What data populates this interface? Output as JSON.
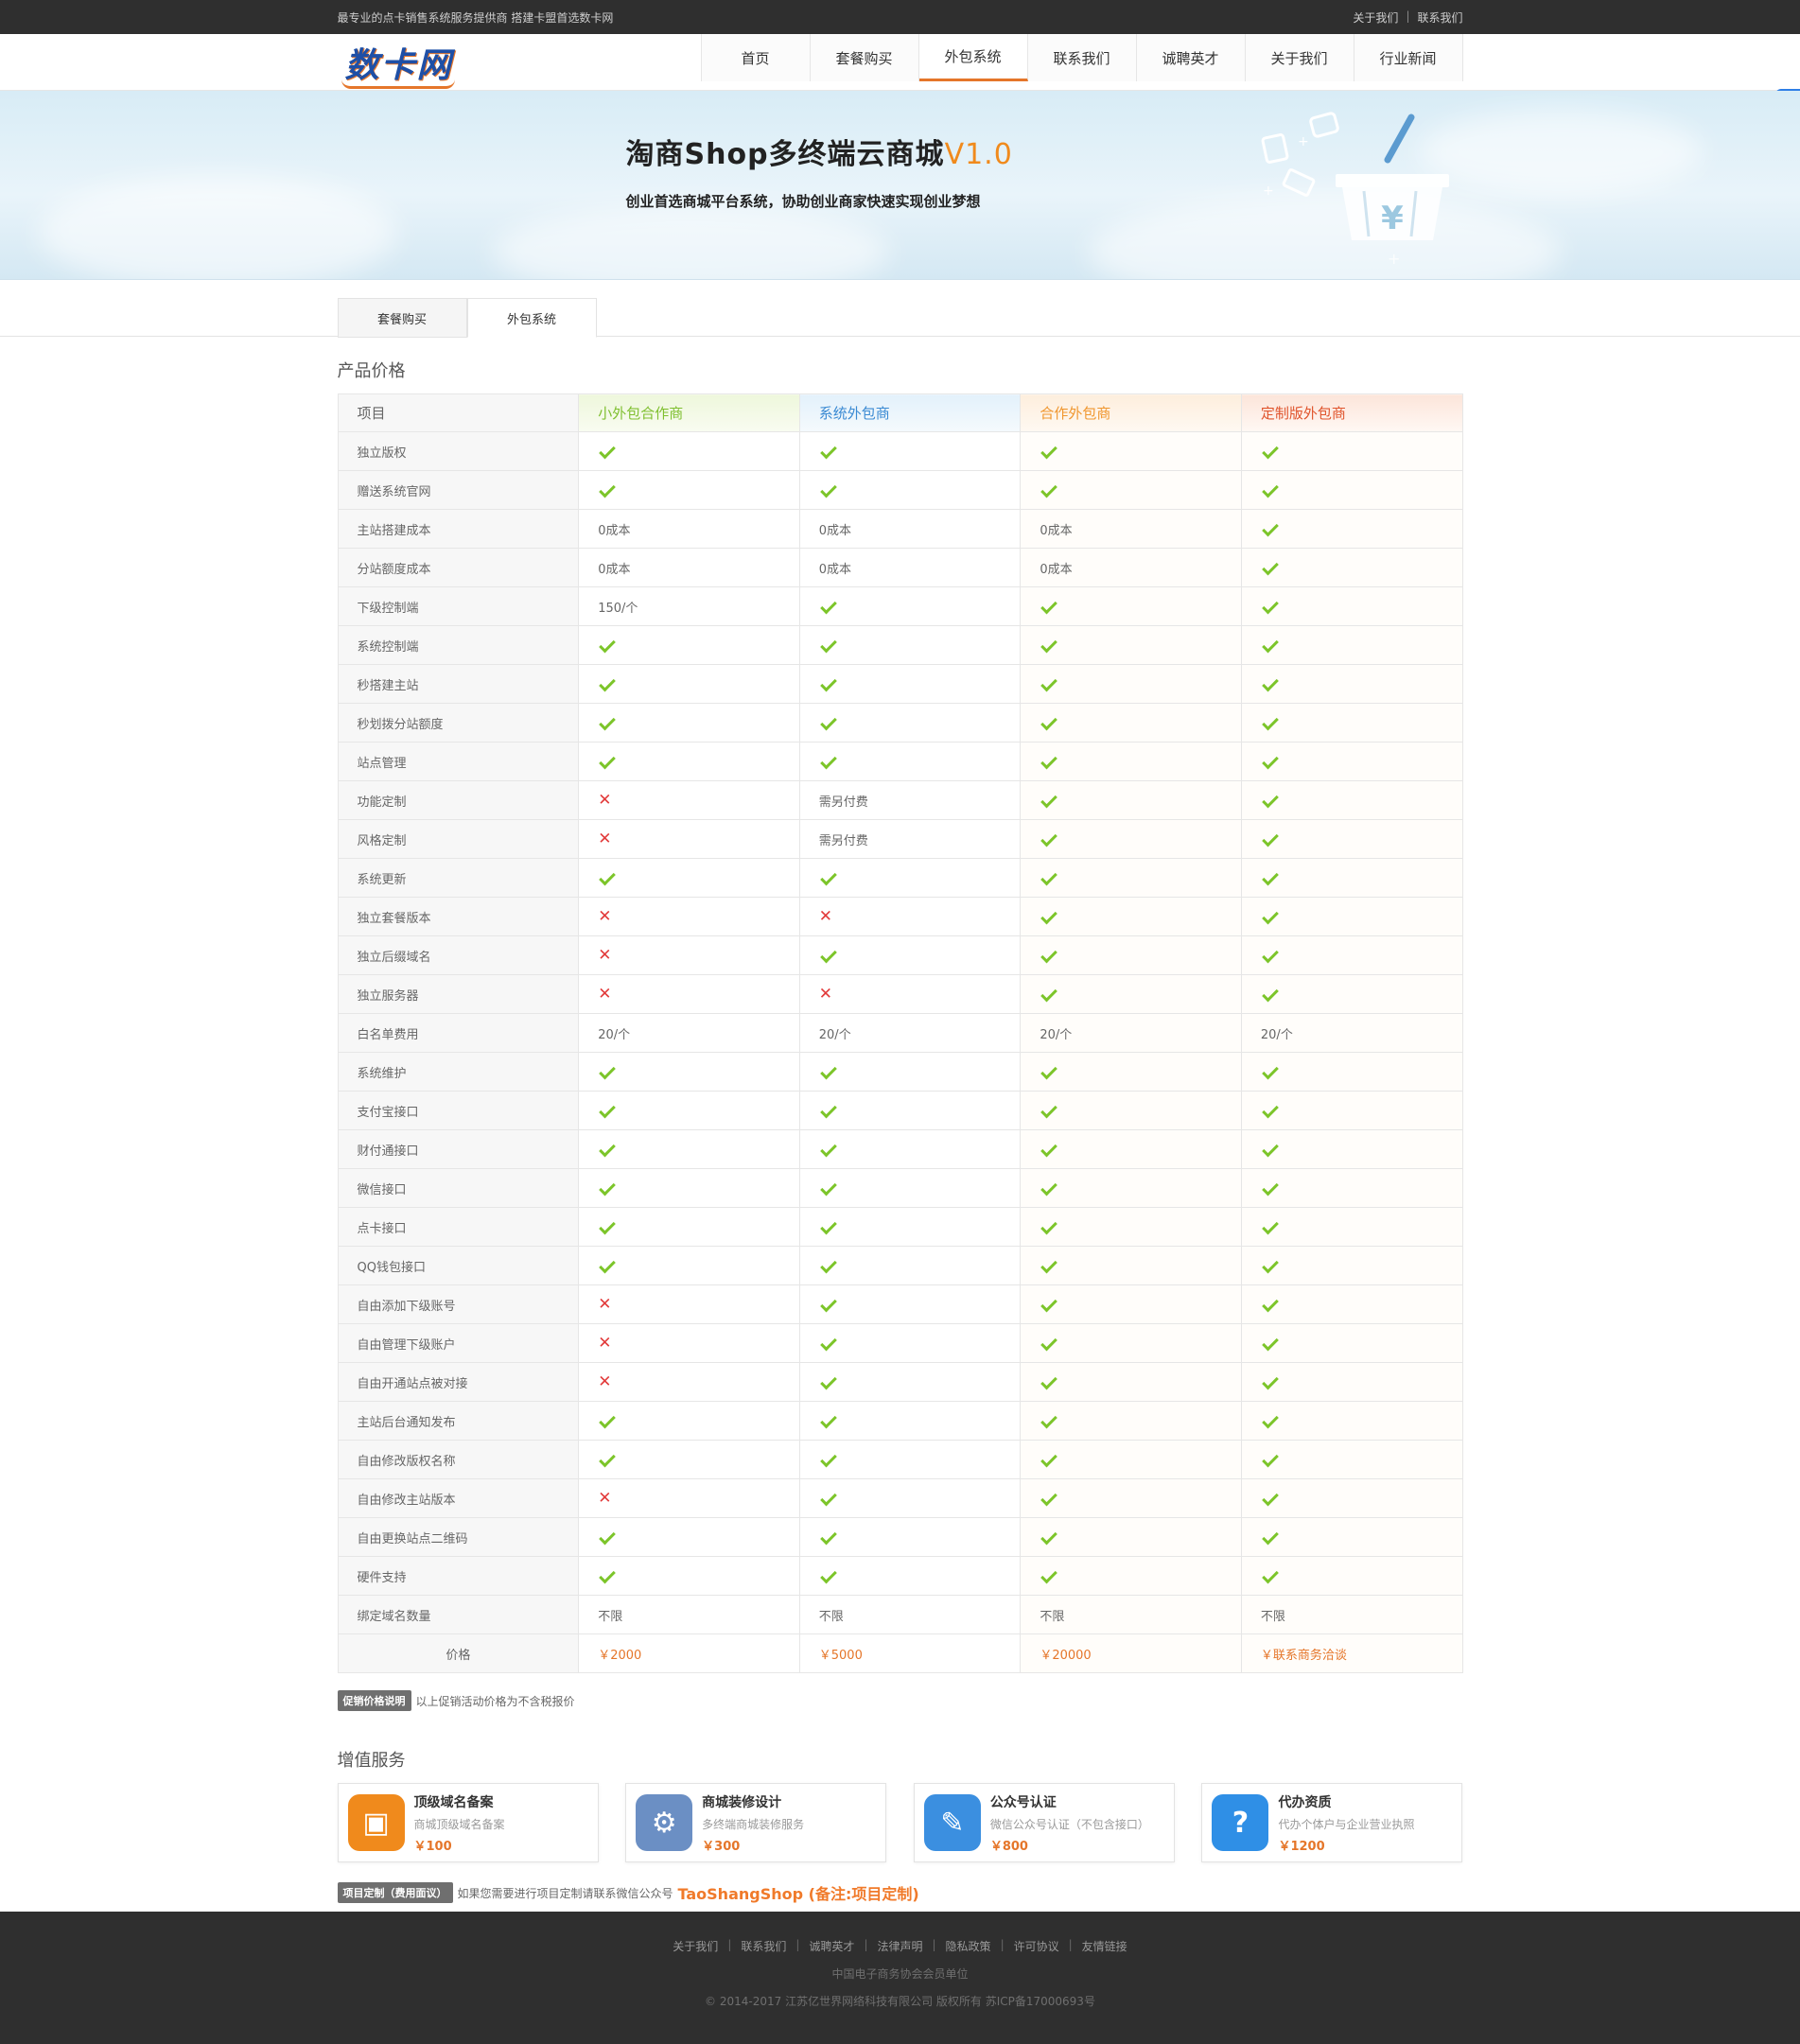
{
  "topbar": {
    "slogan": "最专业的点卡销售系统服务提供商 搭建卡盟首选数卡网",
    "links": [
      "关于我们",
      "联系我们"
    ],
    "separator": "|"
  },
  "header": {
    "logo": "数卡网",
    "nav": [
      "首页",
      "套餐购买",
      "外包系统",
      "联系我们",
      "诚聘英才",
      "关于我们",
      "行业新闻"
    ],
    "active_nav": "外包系统",
    "float_icon": "S"
  },
  "banner": {
    "title": "淘商Shop多终端云商城",
    "version": "V1.0",
    "subtitle": "创业首选商城平台系统，协助创业商家快速实现创业梦想",
    "currency_symbol": "¥"
  },
  "tabs": [
    "套餐购买",
    "外包系统"
  ],
  "active_tab": "外包系统",
  "pricing": {
    "section_title": "产品价格",
    "headers": [
      "项目",
      "小外包合作商",
      "系统外包商",
      "合作外包商",
      "定制版外包商"
    ],
    "rows": [
      {
        "item": "独立版权",
        "v": [
          "check",
          "check",
          "check",
          "check"
        ]
      },
      {
        "item": "赠送系统官网",
        "v": [
          "check",
          "check",
          "check",
          "check"
        ]
      },
      {
        "item": "主站搭建成本",
        "v": [
          "0成本",
          "0成本",
          "0成本",
          "check"
        ]
      },
      {
        "item": "分站额度成本",
        "v": [
          "0成本",
          "0成本",
          "0成本",
          "check"
        ]
      },
      {
        "item": "下级控制端",
        "v": [
          "150/个",
          "check",
          "check",
          "check"
        ]
      },
      {
        "item": "系统控制端",
        "v": [
          "check",
          "check",
          "check",
          "check"
        ]
      },
      {
        "item": "秒搭建主站",
        "v": [
          "check",
          "check",
          "check",
          "check"
        ]
      },
      {
        "item": "秒划拨分站额度",
        "v": [
          "check",
          "check",
          "check",
          "check"
        ]
      },
      {
        "item": "站点管理",
        "v": [
          "check",
          "check",
          "check",
          "check"
        ]
      },
      {
        "item": "功能定制",
        "v": [
          "cross",
          "需另付费",
          "check",
          "check"
        ]
      },
      {
        "item": "风格定制",
        "v": [
          "cross",
          "需另付费",
          "check",
          "check"
        ]
      },
      {
        "item": "系统更新",
        "v": [
          "check",
          "check",
          "check",
          "check"
        ]
      },
      {
        "item": "独立套餐版本",
        "v": [
          "cross",
          "cross",
          "check",
          "check"
        ]
      },
      {
        "item": "独立后缀域名",
        "v": [
          "cross",
          "check",
          "check",
          "check"
        ]
      },
      {
        "item": "独立服务器",
        "v": [
          "cross",
          "cross",
          "check",
          "check"
        ]
      },
      {
        "item": "白名单费用",
        "v": [
          "20/个",
          "20/个",
          "20/个",
          "20/个"
        ]
      },
      {
        "item": "系统维护",
        "v": [
          "check",
          "check",
          "check",
          "check"
        ]
      },
      {
        "item": "支付宝接口",
        "v": [
          "check",
          "check",
          "check",
          "check"
        ]
      },
      {
        "item": "财付通接口",
        "v": [
          "check",
          "check",
          "check",
          "check"
        ]
      },
      {
        "item": "微信接口",
        "v": [
          "check",
          "check",
          "check",
          "check"
        ]
      },
      {
        "item": "点卡接口",
        "v": [
          "check",
          "check",
          "check",
          "check"
        ]
      },
      {
        "item": "QQ钱包接口",
        "v": [
          "check",
          "check",
          "check",
          "check"
        ]
      },
      {
        "item": "自由添加下级账号",
        "v": [
          "cross",
          "check",
          "check",
          "check"
        ]
      },
      {
        "item": "自由管理下级账户",
        "v": [
          "cross",
          "check",
          "check",
          "check"
        ]
      },
      {
        "item": "自由开通站点被对接",
        "v": [
          "cross",
          "check",
          "check",
          "check"
        ]
      },
      {
        "item": "主站后台通知发布",
        "v": [
          "check",
          "check",
          "check",
          "check"
        ]
      },
      {
        "item": "自由修改版权名称",
        "v": [
          "check",
          "check",
          "check",
          "check"
        ]
      },
      {
        "item": "自由修改主站版本",
        "v": [
          "cross",
          "check",
          "check",
          "check"
        ]
      },
      {
        "item": "自由更换站点二维码",
        "v": [
          "check",
          "check",
          "check",
          "check"
        ]
      },
      {
        "item": "硬件支持",
        "v": [
          "check",
          "check",
          "check",
          "check"
        ]
      },
      {
        "item": "绑定域名数量",
        "v": [
          "不限",
          "不限",
          "不限",
          "不限"
        ]
      }
    ],
    "price_row": {
      "item": "价格",
      "v": [
        "￥2000",
        "￥5000",
        "￥20000",
        "￥联系商务洽谈"
      ]
    }
  },
  "promo_note": {
    "badge": "促销价格说明",
    "text": "以上促销活动价格为不含税报价"
  },
  "services": {
    "section_title": "增值服务",
    "items": [
      {
        "title": "顶级域名备案",
        "desc": "商城顶级域名备案",
        "price": "￥100",
        "icon": "box-icon",
        "color": "#f08a1c"
      },
      {
        "title": "商城装修设计",
        "desc": "多终端商城装修服务",
        "price": "￥300",
        "icon": "gear-icon",
        "color": "#6b8fc4"
      },
      {
        "title": "公众号认证",
        "desc": "微信公众号认证（不包含接口）",
        "price": "￥800",
        "icon": "pencil-icon",
        "color": "#3b8fe0"
      },
      {
        "title": "代办资质",
        "desc": "代办个体户与企业营业执照",
        "price": "￥1200",
        "icon": "question-icon",
        "color": "#2f8fe6"
      }
    ]
  },
  "custom_note": {
    "badge": "项目定制（费用面议）",
    "text": "如果您需要进行项目定制请联系微信公众号",
    "wechat": "TaoShangShop (备注:项目定制)"
  },
  "footer": {
    "links": [
      "关于我们",
      "联系我们",
      "诚聘英才",
      "法律声明",
      "隐私政策",
      "许可协议",
      "友情链接"
    ],
    "separator": "|",
    "member": "中国电子商务协会会员单位",
    "copyright": "© 2014-2017 江苏亿世界网络科技有限公司 版权所有 苏ICP备17000693号"
  }
}
